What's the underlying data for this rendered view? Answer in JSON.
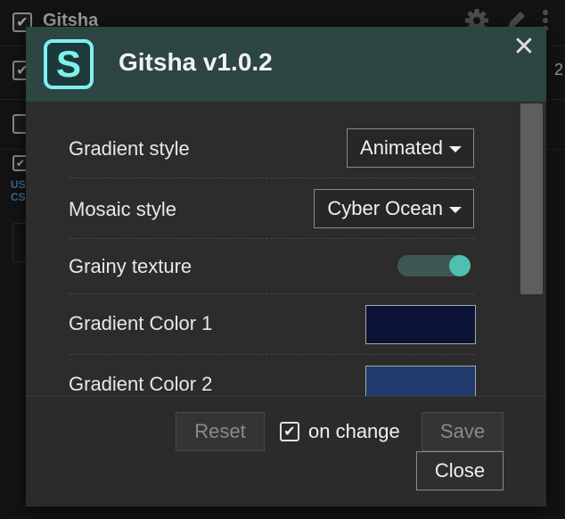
{
  "background": {
    "rows": [
      {
        "title": "Gitsha",
        "checked": "✔"
      },
      {
        "checked": "✔"
      },
      {
        "checked": ""
      }
    ],
    "side_number": "2",
    "blue_text_1": "US",
    "blue_text_2": "CS"
  },
  "dialog": {
    "title": "Gitsha v1.0.2",
    "close_symbol": "✕",
    "logo_letter": "S",
    "settings": [
      {
        "label": "Gradient style",
        "value": "Animated"
      },
      {
        "label": "Mosaic style",
        "value": "Cyber Ocean"
      },
      {
        "label": "Grainy texture",
        "toggle_on": true
      },
      {
        "label": "Gradient Color 1",
        "color": "#0b1336"
      },
      {
        "label": "Gradient Color 2",
        "color": "#213a6e"
      }
    ],
    "footer": {
      "reset_label": "Reset",
      "on_change_label": "on change",
      "on_change_checked": "✔",
      "save_label": "Save",
      "close_label": "Close"
    }
  },
  "colors": {
    "header_bg": "#2d4543",
    "accent_teal": "#4fbfb0"
  }
}
